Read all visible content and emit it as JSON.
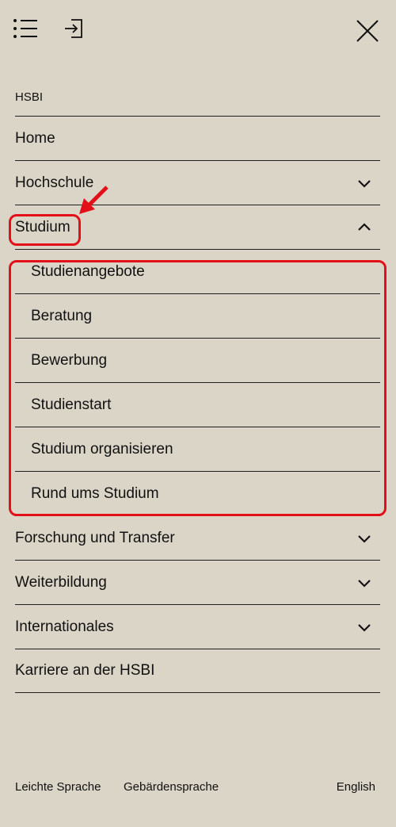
{
  "header": {
    "menu_icon": "list-icon",
    "login_icon": "sign-in-icon",
    "close_icon": "close-icon"
  },
  "section_title": "HSBI",
  "nav": {
    "items": [
      {
        "label": "Home"
      },
      {
        "label": "Hochschule",
        "expandable": true,
        "expanded": false
      },
      {
        "label": "Studium",
        "expandable": true,
        "expanded": true
      },
      {
        "label": "Studienangebote",
        "sub": true
      },
      {
        "label": "Beratung",
        "sub": true
      },
      {
        "label": "Bewerbung",
        "sub": true
      },
      {
        "label": "Studienstart",
        "sub": true
      },
      {
        "label": "Studium organisieren",
        "sub": true
      },
      {
        "label": "Rund ums Studium",
        "sub": true
      },
      {
        "label": "Forschung und Transfer",
        "expandable": true,
        "expanded": false
      },
      {
        "label": "Weiterbildung",
        "expandable": true,
        "expanded": false
      },
      {
        "label": "Internationales",
        "expandable": true,
        "expanded": false
      },
      {
        "label": "Karriere an der HSBI"
      }
    ]
  },
  "footer": {
    "easy_language": "Leichte Sprache",
    "sign_language": "Gebärdensprache",
    "language_switch": "English"
  },
  "colors": {
    "background": "#dbd5c8",
    "annotation": "#e3101a",
    "text": "#111111"
  }
}
